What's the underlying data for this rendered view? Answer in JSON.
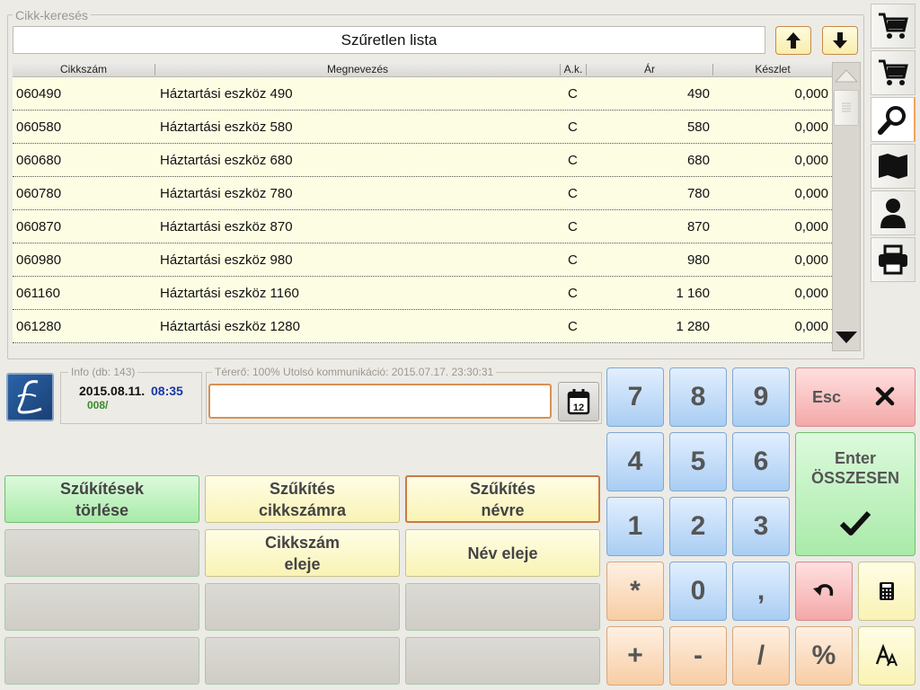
{
  "search": {
    "legend": "Cikk-keresés",
    "filter_text": "Szűretlen lista"
  },
  "table": {
    "headers": [
      "Cikkszám",
      "Megnevezés",
      "A.k.",
      "Ár",
      "Készlet"
    ],
    "rows": [
      {
        "code": "060490",
        "name": "Háztartási eszköz 490",
        "ak": "C",
        "price": "490",
        "stock": "0,000"
      },
      {
        "code": "060580",
        "name": "Háztartási eszköz 580",
        "ak": "C",
        "price": "580",
        "stock": "0,000"
      },
      {
        "code": "060680",
        "name": "Háztartási eszköz 680",
        "ak": "C",
        "price": "680",
        "stock": "0,000"
      },
      {
        "code": "060780",
        "name": "Háztartási eszköz 780",
        "ak": "C",
        "price": "780",
        "stock": "0,000"
      },
      {
        "code": "060870",
        "name": "Háztartási eszköz 870",
        "ak": "C",
        "price": "870",
        "stock": "0,000"
      },
      {
        "code": "060980",
        "name": "Háztartási eszköz 980",
        "ak": "C",
        "price": "980",
        "stock": "0,000"
      },
      {
        "code": "061160",
        "name": "Háztartási eszköz 1160",
        "ak": "C",
        "price": "1 160",
        "stock": "0,000"
      },
      {
        "code": "061280",
        "name": "Háztartási eszköz 1280",
        "ak": "C",
        "price": "1 280",
        "stock": "0,000"
      }
    ]
  },
  "side_menu": [
    "cart-icon",
    "cart-icon",
    "search-icon",
    "map-icon",
    "user-icon",
    "printer-icon"
  ],
  "info": {
    "legend": "Info (db: 143)",
    "date": "2015.08.11.",
    "time": "08:35",
    "code": "008/"
  },
  "status": {
    "legend": "Térerő: 100%  Utolsó kommunikáció: 2015.07.17. 23:30:31",
    "input_value": ""
  },
  "calendar": {
    "day": "12"
  },
  "function_buttons": {
    "clear_filters": "Szűkítések\ntörlése",
    "filter_code": "Szűkítés\ncikkszámra",
    "filter_name": "Szűkítés\nnévre",
    "code_start": "Cikkszám\neleje",
    "name_start": "Név eleje"
  },
  "keypad": {
    "k7": "7",
    "k8": "8",
    "k9": "9",
    "k4": "4",
    "k5": "5",
    "k6": "6",
    "k1": "1",
    "k2": "2",
    "k3": "3",
    "kstar": "*",
    "k0": "0",
    "kcomma": ",",
    "kplus": "+",
    "kminus": "-",
    "kslash": "/",
    "kpercent": "%",
    "esc": "Esc",
    "enter_line1": "Enter",
    "enter_line2": "ÖSSZESEN"
  },
  "colors": {
    "accent_orange": "#cb7a45",
    "row_background": "#fdfde3",
    "time_blue": "#1637a8"
  }
}
